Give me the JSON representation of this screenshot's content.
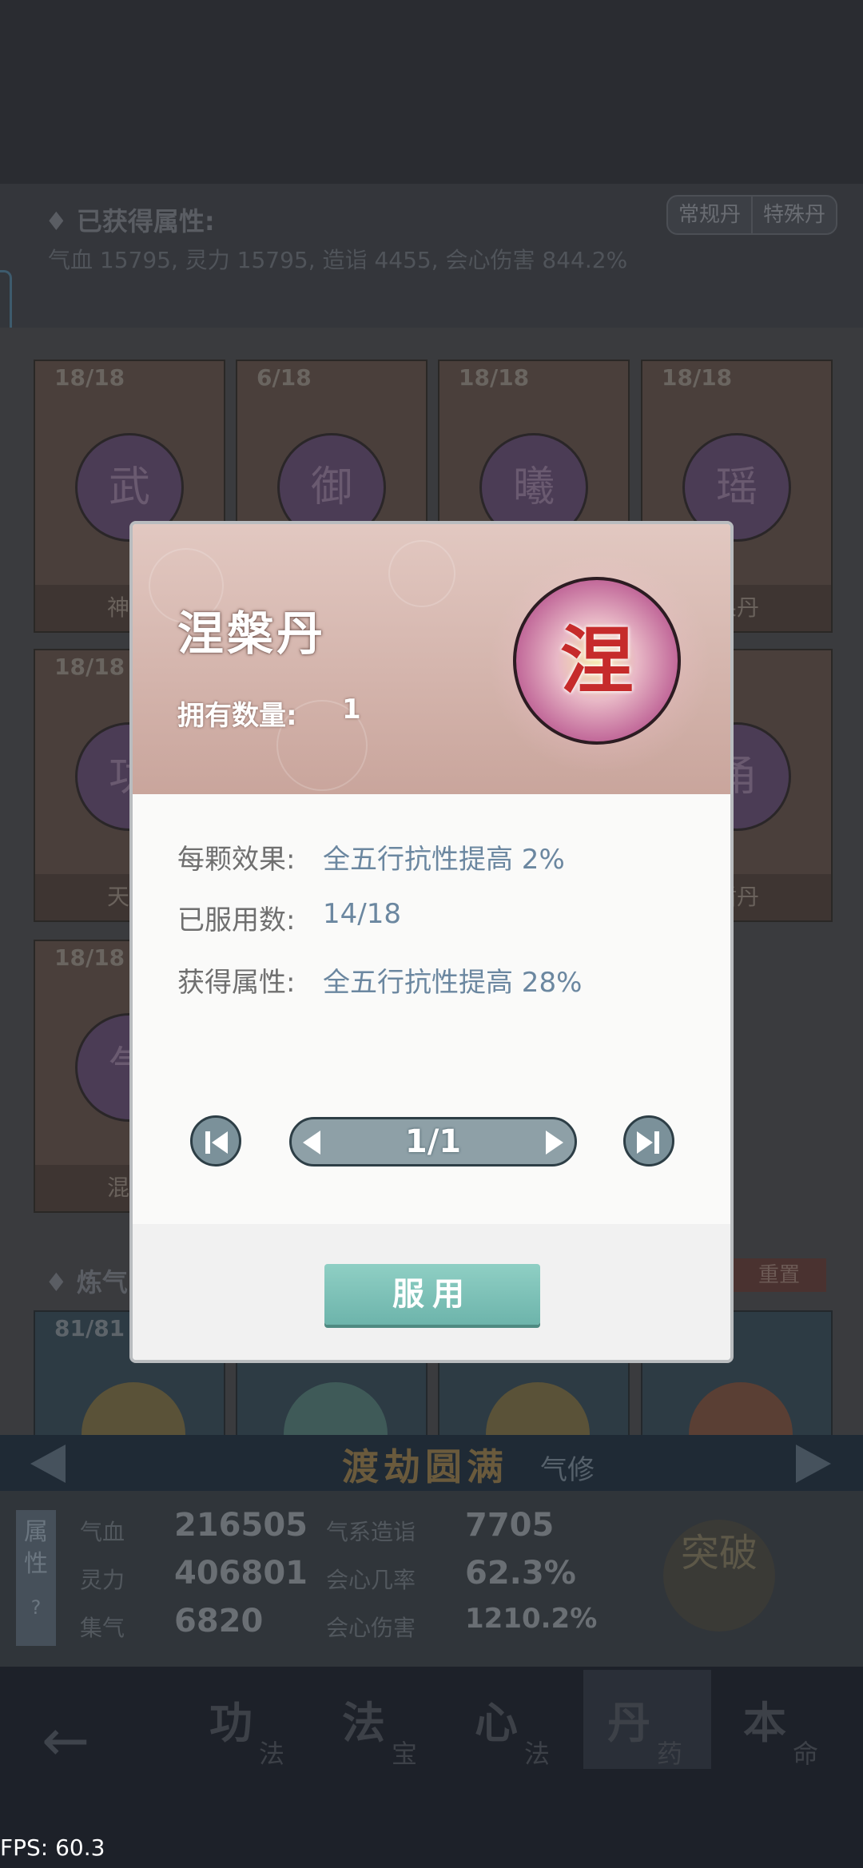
{
  "attributes": {
    "title": "已获得属性:",
    "text": "气血 15795, 灵力 15795, 造诣 4455, 会心伤害 844.2%",
    "tabs": [
      "常规丹",
      "特殊丹"
    ]
  },
  "grid": {
    "row1": [
      {
        "count": "18/18",
        "char": "武",
        "name": "神武"
      },
      {
        "count": "6/18",
        "char": "御",
        "name": ""
      },
      {
        "count": "18/18",
        "char": "曦",
        "name": ""
      },
      {
        "count": "18/18",
        "char": "瑶",
        "name": "果丹"
      }
    ],
    "row2": [
      {
        "count": "18/18",
        "char": "功",
        "name": "天班"
      },
      {
        "count": "",
        "char": "甬",
        "name": "盾丹"
      }
    ],
    "row3": [
      {
        "count": "18/18",
        "char": "气",
        "name": "混沌"
      }
    ]
  },
  "section2": {
    "title": "炼气",
    "reset": "重置",
    "first_count": "81/81"
  },
  "realm": {
    "name": "渡劫圆满",
    "sub": "气修"
  },
  "stats": {
    "tag": "属性",
    "help": "?",
    "items": [
      {
        "label": "气血",
        "value": "216505"
      },
      {
        "label": "灵力",
        "value": "406801"
      },
      {
        "label": "集气",
        "value": "6820"
      },
      {
        "label": "气系造诣",
        "value": "7705"
      },
      {
        "label": "会心几率",
        "value": "62.3%"
      },
      {
        "label": "会心伤害",
        "value": "1210.2%"
      }
    ],
    "breakthrough": "突破"
  },
  "bottom_nav": [
    {
      "main": "功",
      "sub": "法"
    },
    {
      "main": "法",
      "sub": "宝"
    },
    {
      "main": "心",
      "sub": "法"
    },
    {
      "main": "丹",
      "sub": "药"
    },
    {
      "main": "本",
      "sub": "命"
    }
  ],
  "dialog": {
    "title": "涅槃丹",
    "own_label": "拥有数量:",
    "own_value": "1",
    "pill_char": "涅",
    "effect_label": "每颗效果:",
    "effect_value": "全五行抗性提高 2%",
    "used_label": "已服用数:",
    "used_value": "14/18",
    "gain_label": "获得属性:",
    "gain_value": "全五行抗性提高 28%",
    "page": "1/1",
    "use_label": "服用"
  },
  "fps": "FPS: 60.3"
}
